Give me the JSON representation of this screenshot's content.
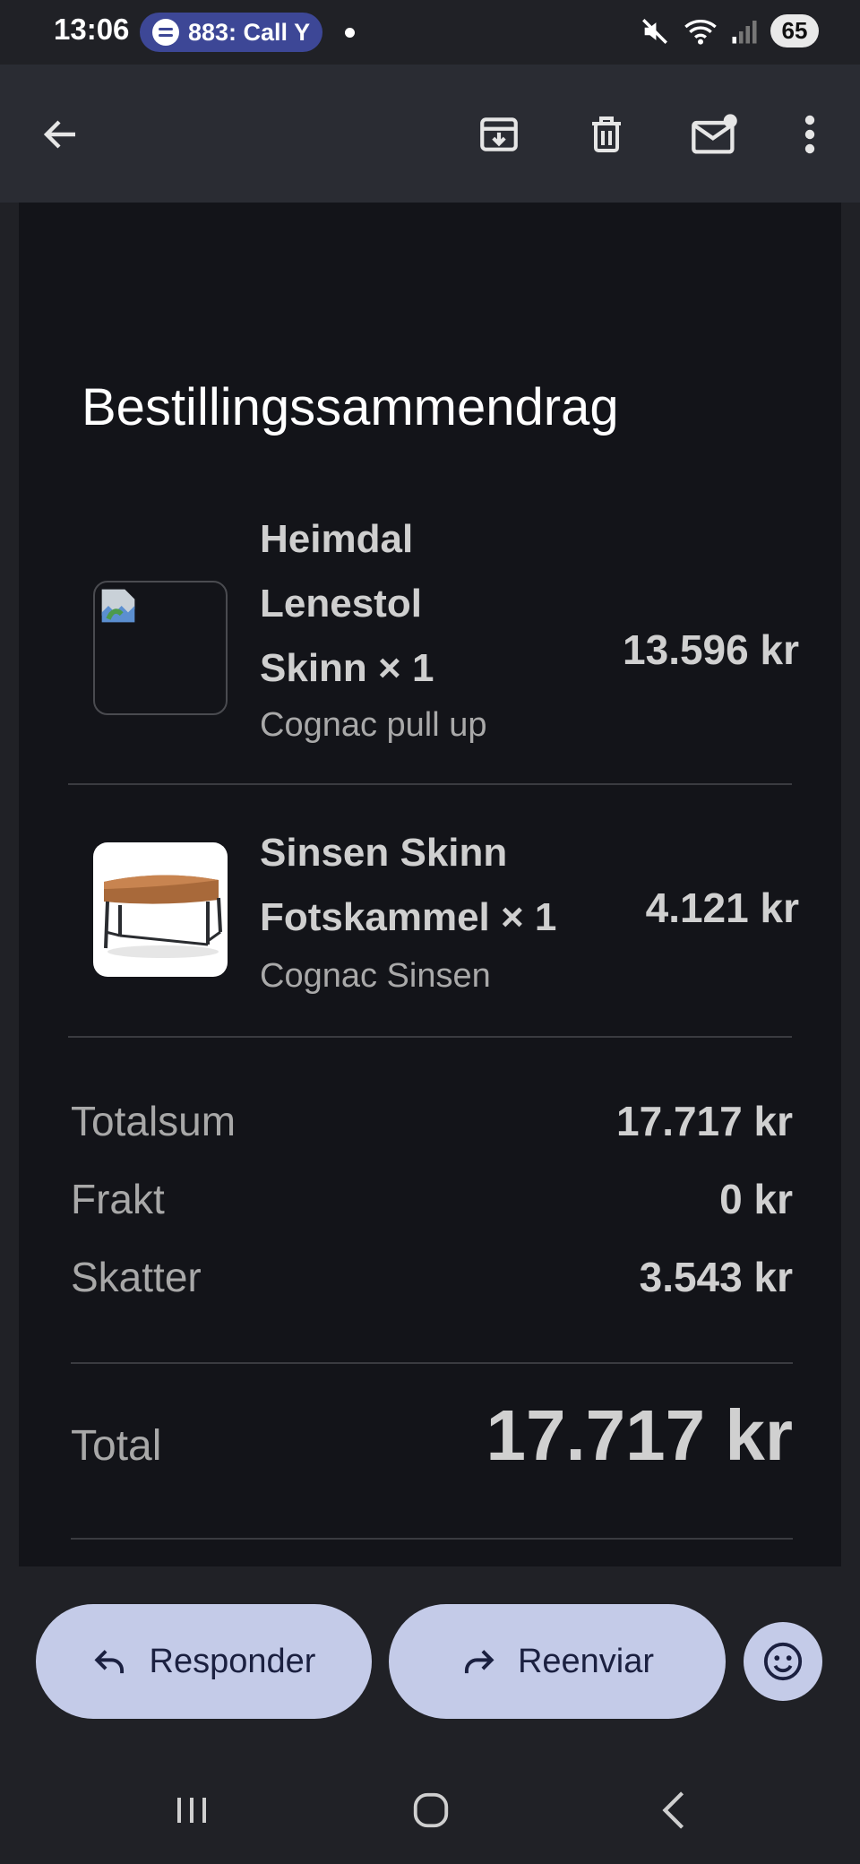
{
  "status_bar": {
    "time": "13:06",
    "now_playing": "883: Call Y",
    "battery": "65",
    "icons": [
      "spotify-icon",
      "mute-icon",
      "wifi-icon",
      "signal-icon",
      "battery-icon"
    ]
  },
  "app_bar": {
    "icons": [
      "back-arrow-icon",
      "archive-icon",
      "delete-icon",
      "mark-unread-icon",
      "more-vert-icon"
    ]
  },
  "email": {
    "title": "Bestillingssammendrag",
    "items": [
      {
        "name_lines": [
          "Heimdal",
          "Lenestol",
          "Skinn × 1"
        ],
        "variant": "Cognac pull up",
        "price": "13.596 kr",
        "image": "broken-image-icon"
      },
      {
        "name_lines": [
          "Sinsen Skinn",
          "Fotskammel × 1"
        ],
        "variant": "Cognac Sinsen",
        "price": "4.121 kr",
        "image": "footstool-image"
      }
    ],
    "summary": [
      {
        "label": "Totalsum",
        "value": "17.717 kr"
      },
      {
        "label": "Frakt",
        "value": "0 kr"
      },
      {
        "label": "Skatter",
        "value": "3.543 kr"
      }
    ],
    "total": {
      "label": "Total",
      "value": "17.717 kr"
    }
  },
  "actions": {
    "reply_label": "Responder",
    "forward_label": "Reenviar",
    "emoji_icon": "emoji-reaction-icon"
  },
  "nav_bar": {
    "icons": [
      "recent-apps-icon",
      "home-icon",
      "back-icon"
    ]
  },
  "colors": {
    "background": "#202126",
    "email_body": "#131419",
    "app_bar": "#2a2c33",
    "button": "#c4cbe8",
    "spotify_pill": "#3d4796"
  }
}
